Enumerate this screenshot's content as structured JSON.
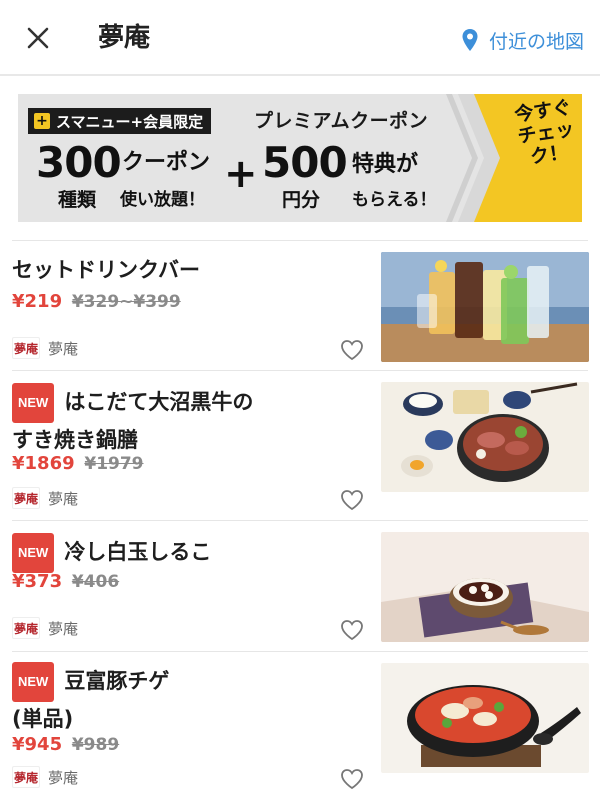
{
  "header": {
    "title": "夢庵",
    "map_link": "付近の地図"
  },
  "banner": {
    "tag": "スマニュー+会員限定",
    "tag_plus": "+",
    "premium": "プレミアムクーポン",
    "num1": "300",
    "coupon": "クーポン",
    "kinds": "種類",
    "unlimited": "使い放題！",
    "plus": "+",
    "num2": "500",
    "yen": "円分",
    "tokuten": "特典が",
    "moraeru": "もらえる！",
    "check": "今すぐチェック！"
  },
  "items": [
    {
      "name": "セットドリンクバー",
      "is_new": false,
      "price": "¥219",
      "old_price": "¥329~¥399",
      "shop": "夢庵",
      "image": "drink-bar-photo"
    },
    {
      "badge": "NEW",
      "name_line1": "はこだて大沼黒牛の",
      "name_line2": "すき焼き鍋膳",
      "is_new": true,
      "price": "¥1869",
      "old_price": "¥1979",
      "shop": "夢庵",
      "image": "sukiyaki-set-photo"
    },
    {
      "badge": "NEW",
      "name": "冷し白玉しるこ",
      "is_new": true,
      "price": "¥373",
      "old_price": "¥406",
      "shop": "夢庵",
      "image": "shiratama-shiruko-photo"
    },
    {
      "badge": "NEW",
      "name_line1": "豆富豚チゲ",
      "name_line2": "(単品)",
      "is_new": true,
      "price": "¥945",
      "old_price": "¥989",
      "shop": "夢庵",
      "image": "tofu-pork-chige-photo"
    }
  ],
  "colors": {
    "accent_red": "#e2453c",
    "link_blue": "#3d8fd9",
    "banner_yellow": "#f3c623"
  },
  "shop_logo_text": "夢庵"
}
